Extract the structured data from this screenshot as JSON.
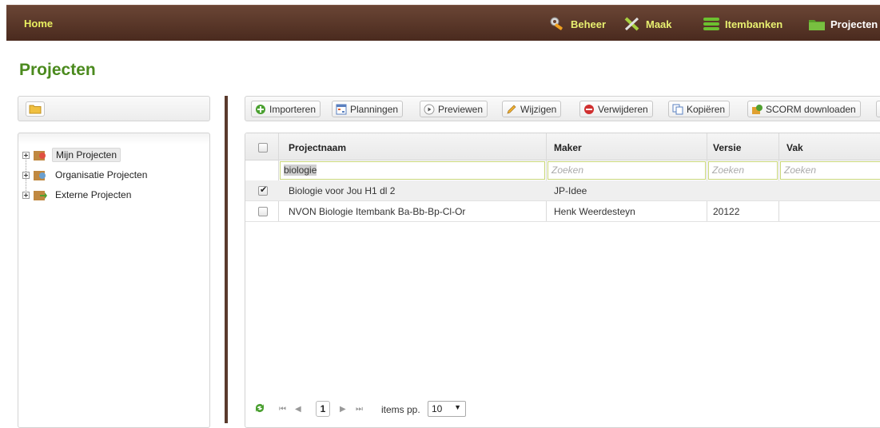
{
  "topbar": {
    "home": "Home",
    "nav": [
      {
        "label": "Beheer",
        "icon": "wrench-icon"
      },
      {
        "label": "Maak",
        "icon": "tools-icon"
      },
      {
        "label": "Itembanken",
        "icon": "database-icon"
      },
      {
        "label": "Projecten",
        "icon": "folder-icon"
      }
    ]
  },
  "page": {
    "title": "Projecten"
  },
  "tree": {
    "items": [
      {
        "label": "Mijn Projecten",
        "selected": true
      },
      {
        "label": "Organisatie Projecten",
        "selected": false
      },
      {
        "label": "Externe Projecten",
        "selected": false
      }
    ]
  },
  "toolbar": {
    "buttons": [
      {
        "label": "Importeren",
        "icon": "add-circle-icon"
      },
      {
        "label": "Planningen",
        "icon": "calendar-icon"
      },
      {
        "label": "Previewen",
        "icon": "play-circle-icon"
      },
      {
        "label": "Wijzigen",
        "icon": "pencil-icon"
      },
      {
        "label": "Verwijderen",
        "icon": "delete-circle-icon"
      },
      {
        "label": "Kopiëren",
        "icon": "copy-icon"
      },
      {
        "label": "SCORM downloaden",
        "icon": "scorm-package-icon"
      }
    ]
  },
  "grid": {
    "columns": [
      "Projectnaam",
      "Maker",
      "Versie",
      "Vak"
    ],
    "filters": {
      "projectnaam": "biologie",
      "placeholder": "Zoeken"
    },
    "rows": [
      {
        "checked": true,
        "projectnaam": "Biologie voor Jou H1 dl 2",
        "maker": "JP-Idee",
        "versie": "",
        "vak": ""
      },
      {
        "checked": false,
        "projectnaam": "NVON Biologie Itembank Ba-Bb-Bp-Cl-Or",
        "maker": "Henk Weerdesteyn",
        "versie": "20122",
        "vak": ""
      }
    ]
  },
  "pager": {
    "page": "1",
    "items_label": "items pp.",
    "items_value": "10"
  },
  "colors": {
    "topbar": "#4a2a1e",
    "nav_text": "#e8f070",
    "title": "#4b8a1e"
  }
}
